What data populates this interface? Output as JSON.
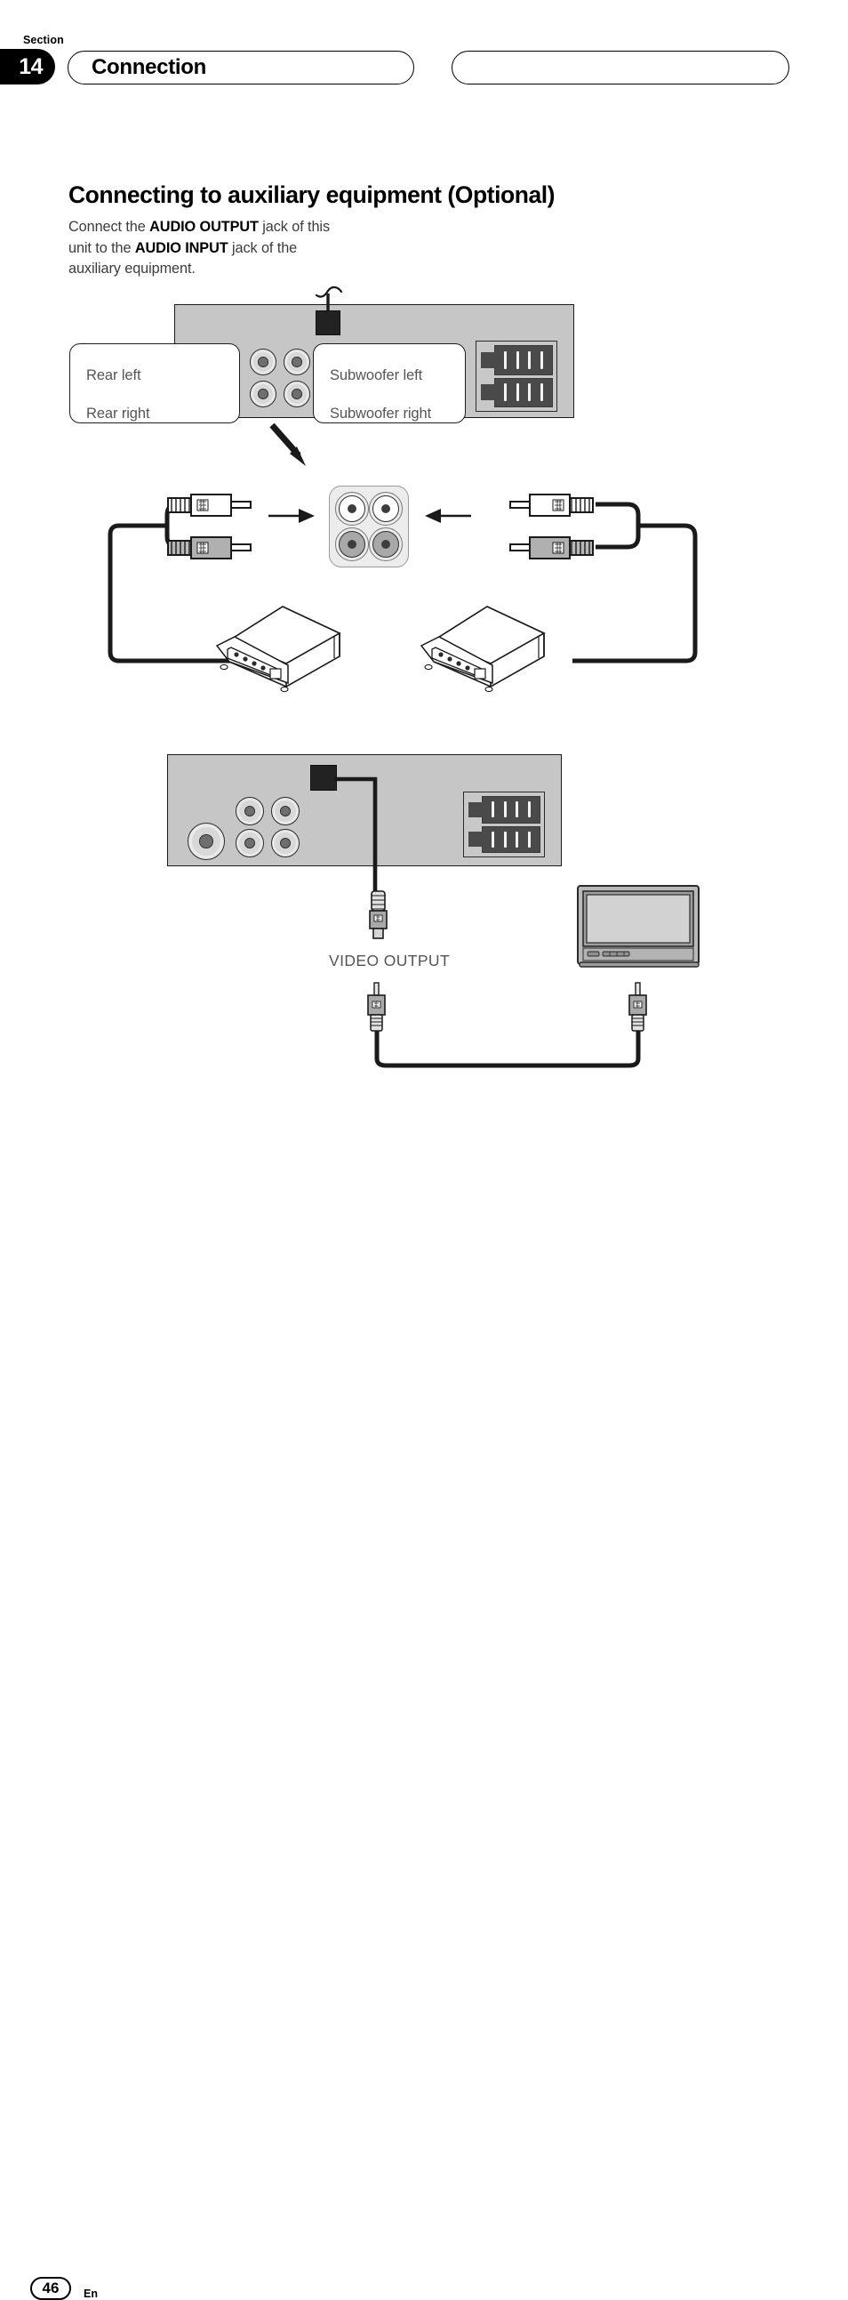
{
  "header": {
    "section_word": "Section",
    "section_number": "14",
    "chapter_title": "Connection",
    "right_pill_label": ""
  },
  "main": {
    "page_title": "Connecting to auxiliary equipment (Optional)",
    "intro_parts": {
      "p1": "Connect the ",
      "b1": "AUDIO OUTPUT",
      "p2": " jack of this unit to the ",
      "b2": "AUDIO INPUT",
      "p3": " jack of the auxiliary equipment."
    }
  },
  "diagram": {
    "callouts": {
      "rear_left": "Rear left",
      "rear_right": "Rear right",
      "subwoofer_left": "Subwoofer left",
      "subwoofer_right": "Subwoofer right"
    },
    "video_output_label": "VIDEO OUTPUT",
    "icons": {
      "antenna": "antenna-connector-icon",
      "rca_jack": "rca-jack-icon",
      "terminal_block": "wiring-harness-connector-icon",
      "amplifier": "amplifier-unit-icon",
      "monitor": "display-monitor-icon",
      "rca_plug": "rca-plug-icon",
      "arrow_down": "arrow-down-right-icon",
      "arrow_right": "arrow-right-icon",
      "arrow_left": "arrow-left-icon"
    },
    "colors": {
      "chassis": "#c6c6c6",
      "terminal": "#4a4a4a",
      "plug_white": "#ffffff",
      "plug_gray": "#a8a8a8",
      "outline": "#1a1a1a"
    }
  },
  "footer": {
    "page_number": "46",
    "language": "En"
  }
}
